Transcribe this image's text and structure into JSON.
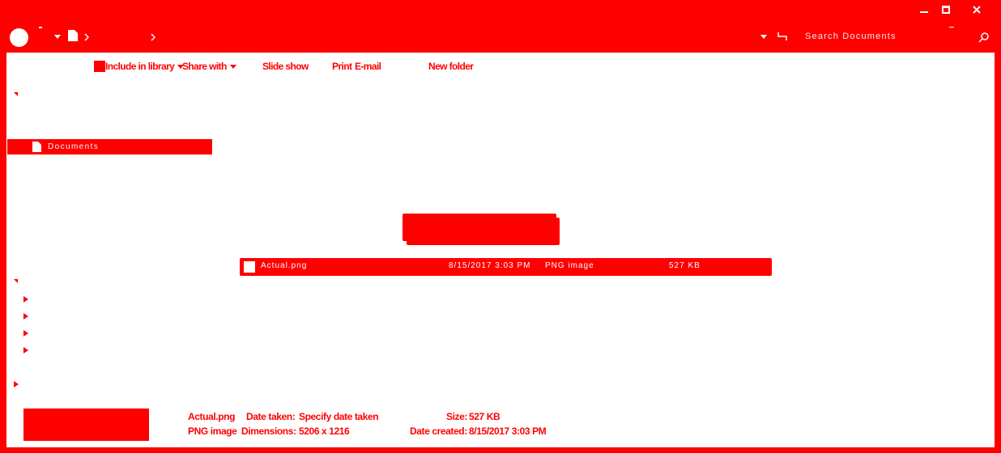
{
  "window": {
    "buttons": {
      "minimize": "minimize",
      "maximize": "maximize",
      "close": "close"
    },
    "search_placeholder": "Search Documents"
  },
  "toolbar": {
    "include_in_library": "Include in library",
    "share_with": "Share with",
    "slide_show": "Slide show",
    "print": "Print",
    "email": "E-mail",
    "new_folder": "New folder"
  },
  "nav": {
    "selected_item": "Documents"
  },
  "file_list": {
    "rows": [
      {
        "name": "Actual.png",
        "date": "8/15/2017 3:03 PM",
        "type": "PNG image",
        "size": "527 KB"
      }
    ]
  },
  "details": {
    "filename": "Actual.png",
    "filetype": "PNG image",
    "date_taken_label": "Date taken:",
    "date_taken_value": "Specify date taken",
    "dimensions_label": "Dimensions:",
    "dimensions_value": "5206 x 1216",
    "size_label": "Size:",
    "size_value": "527 KB",
    "date_created_label": "Date created:",
    "date_created_value": "8/15/2017 3:03 PM"
  },
  "colors": {
    "accent": "#ff0000",
    "background": "#ffffff"
  },
  "icons": [
    "back-circle-icon",
    "dropdown-icon",
    "folder-icon",
    "chevron-right-icon",
    "refresh-icon",
    "search-icon",
    "window-minimize-icon",
    "window-maximize-icon",
    "window-close-icon"
  ]
}
